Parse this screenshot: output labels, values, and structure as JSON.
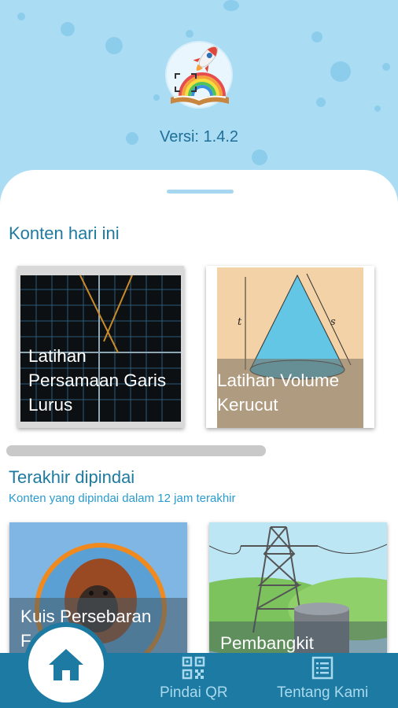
{
  "header": {
    "version": "Versi: 1.4.2",
    "logo_icon": "rocket-rainbow-book-logo-icon"
  },
  "today": {
    "title": "Konten hari ini",
    "cards": [
      {
        "label": "Latihan Persamaan Garis Lurus",
        "image": "graph-lines-image"
      },
      {
        "label": "Latihan Volume Kerucut",
        "image": "cone-diagram-image"
      }
    ]
  },
  "recent": {
    "title": "Terakhir dipindai",
    "subtitle": "Konten yang dipindai dalam 12 jam terakhir",
    "cards": [
      {
        "label": "Kuis Persebaran F...",
        "image": "orangutan-image"
      },
      {
        "label": "Pembangkit",
        "image": "power-tower-image"
      }
    ]
  },
  "nav": {
    "home_icon": "home-icon",
    "scan_label": "Pindai QR",
    "scan_icon": "qr-code-icon",
    "about_label": "Tentang Kami",
    "about_icon": "document-list-icon"
  },
  "colors": {
    "sky": "#aadcf3",
    "primary": "#1d7aa2",
    "accent": "#2a9ad0"
  }
}
